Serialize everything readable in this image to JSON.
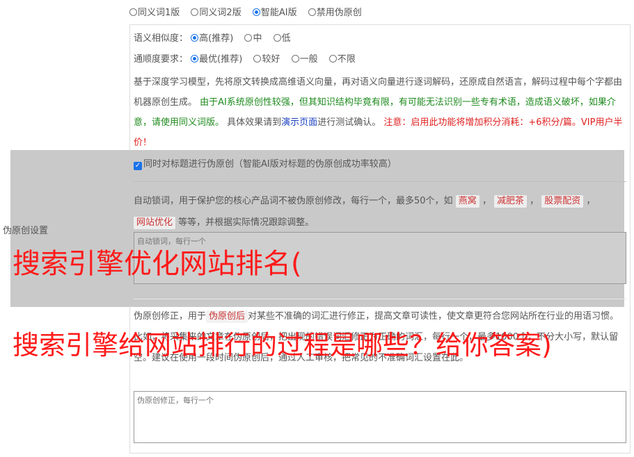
{
  "modes": {
    "items": [
      "同义词1版",
      "同义词2版",
      "智能AI版",
      "禁用伪原创"
    ],
    "selected": "智能AI版"
  },
  "similarity": {
    "label": "语义相似度：",
    "options": [
      "高(推荐)",
      "中",
      "低"
    ],
    "selected": "高(推荐)"
  },
  "fluency": {
    "label": "通顺度要求：",
    "options": [
      "最优(推荐)",
      "较好",
      "一般",
      "不限"
    ],
    "selected": "最优(推荐)"
  },
  "description": {
    "part1": "基于深度学习模型，先将原文转换成高维语义向量，再对语义向量进行逐词解码，还原成自然语言，解码过程中每个字都由机器原创生成。",
    "green": "由于AI系统原创性较强，但其知识结构毕竟有限，有可能无法识别一些专有术语，造成语义破坏，如果介意，请使用同义词版。",
    "part2": "具体效果请到",
    "link": "演示页面",
    "part3": "进行测试确认。",
    "red": "注意：启用此功能将增加积分消耗：+6积分/篇。VIP用户半价！"
  },
  "side_label": "伪原创设置",
  "title_option": "同时对标题进行伪原创（智能AI版对标题的伪原创成功率较高）",
  "lock": {
    "desc_before": "自动锁词，用于保护您的核心产品词不被伪原创修改，每行一个，最多50个，如",
    "tags": [
      "燕窝",
      "减肥茶",
      "股票配资",
      "网站优化"
    ],
    "desc_after": "等等，并根据实际情况跟踪调整。",
    "placeholder": "自动锁词，每行一个"
  },
  "fix": {
    "desc_before": "伪原创修正，用于",
    "tag": "伪原创后",
    "desc_after": "对某些不准确的词汇进行修正，提高文章可读性，使文章更符合您网站所在行业的用语习惯。比如，将采集来的文章在伪原创后，把出现的错误词汇修正为正确的词汇，每行一个，最多1000个，不分大小写，默认留空。建议在使用一段时间伪原创后，通过人工审核，把常见的不准确词汇设置在此。",
    "placeholder": "伪原创修正，每行一个"
  },
  "overlay": {
    "line1": "搜索引擎优化网站排名(",
    "line2": "搜索引擎给网站排行的过程是哪些？给你答案)"
  },
  "colors": {
    "accent": "#1a73e8",
    "green": "#1e8a1e",
    "red": "#e02020",
    "overlay": "#ff1a1a"
  }
}
